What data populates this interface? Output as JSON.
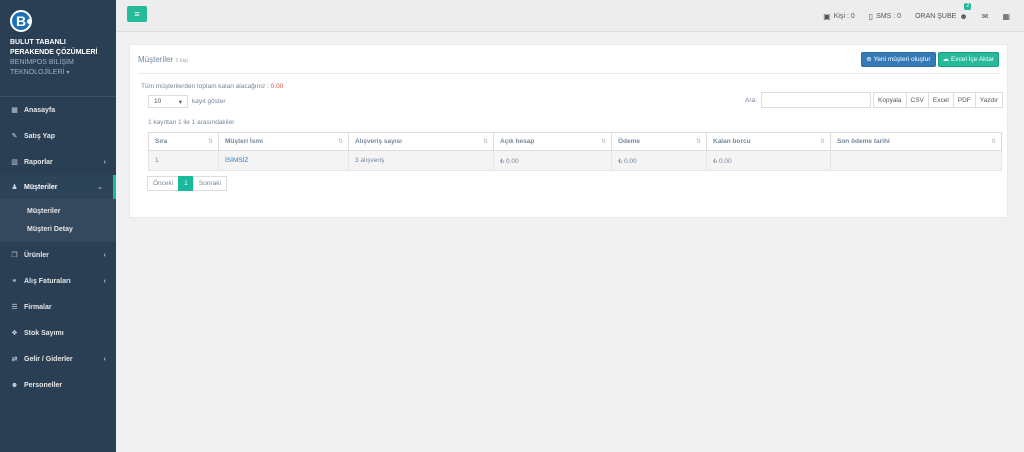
{
  "brand": {
    "logo_letter": "B",
    "name_line1": "BULUT TABANLI",
    "name_line2": "PERAKENDE ÇÖZÜMLERİ",
    "sub_line1": "BENİMPOS BİLİŞİM",
    "sub_line2": "TEKNOLOJİLERİ"
  },
  "sidebar": {
    "items": [
      {
        "label": "Anasayfa",
        "icon": "dashboard-icon"
      },
      {
        "label": "Satış Yap",
        "icon": "edit-icon"
      },
      {
        "label": "Raporlar",
        "icon": "bar-chart-icon"
      },
      {
        "label": "Müşteriler",
        "icon": "male-icon"
      },
      {
        "label": "Ürünler",
        "icon": "copy-icon"
      },
      {
        "label": "Alış Faturaları",
        "icon": "link-icon"
      },
      {
        "label": "Firmalar",
        "icon": "list-icon"
      },
      {
        "label": "Stok Sayımı",
        "icon": "cubes-icon"
      },
      {
        "label": "Gelir / Giderler",
        "icon": "exchange-icon"
      },
      {
        "label": "Personeller",
        "icon": "users-icon"
      }
    ],
    "sub_items": [
      "Müşteriler",
      "Müşteri Detay"
    ]
  },
  "topbar": {
    "kisi": "Kişi : 0",
    "sms": "SMS : 0",
    "branch": "ORAN ŞUBE",
    "badge": "2"
  },
  "panel": {
    "title": "Müşteriler",
    "title_small": "1 kişi",
    "btn_new": "Yeni müşteri oluştur",
    "btn_excel": "Excel İçe Aktar",
    "total_label": "Tüm müşterilerden toplam kalan alacağınız :",
    "total_value": "0.00",
    "length_value": "10",
    "length_label": "kayıt göster",
    "search_label": "Ara:",
    "export": [
      "Kopyala",
      "CSV",
      "Excel",
      "PDF",
      "Yazdır"
    ],
    "info": "1 kayıttan 1 ile 1 arasındakiler",
    "columns": [
      "Sıra",
      "Müşteri İsmi",
      "Alışveriş sayısı",
      "Açık hesap",
      "Ödeme",
      "Kalan borcu",
      "Son ödeme tarihi"
    ],
    "rows": [
      [
        "1",
        "İSİMSİZ",
        "3 alışveriş",
        "₺ 0.00",
        "₺ 0.00",
        "₺ 0.00",
        ""
      ]
    ],
    "pager": {
      "prev": "Önceki",
      "page": "1",
      "next": "Sonraki"
    }
  },
  "colors": {
    "sidebar_bg": "#2a3f54",
    "accent": "#26b99a",
    "primary": "#337ab7",
    "danger": "#e74c3c"
  }
}
